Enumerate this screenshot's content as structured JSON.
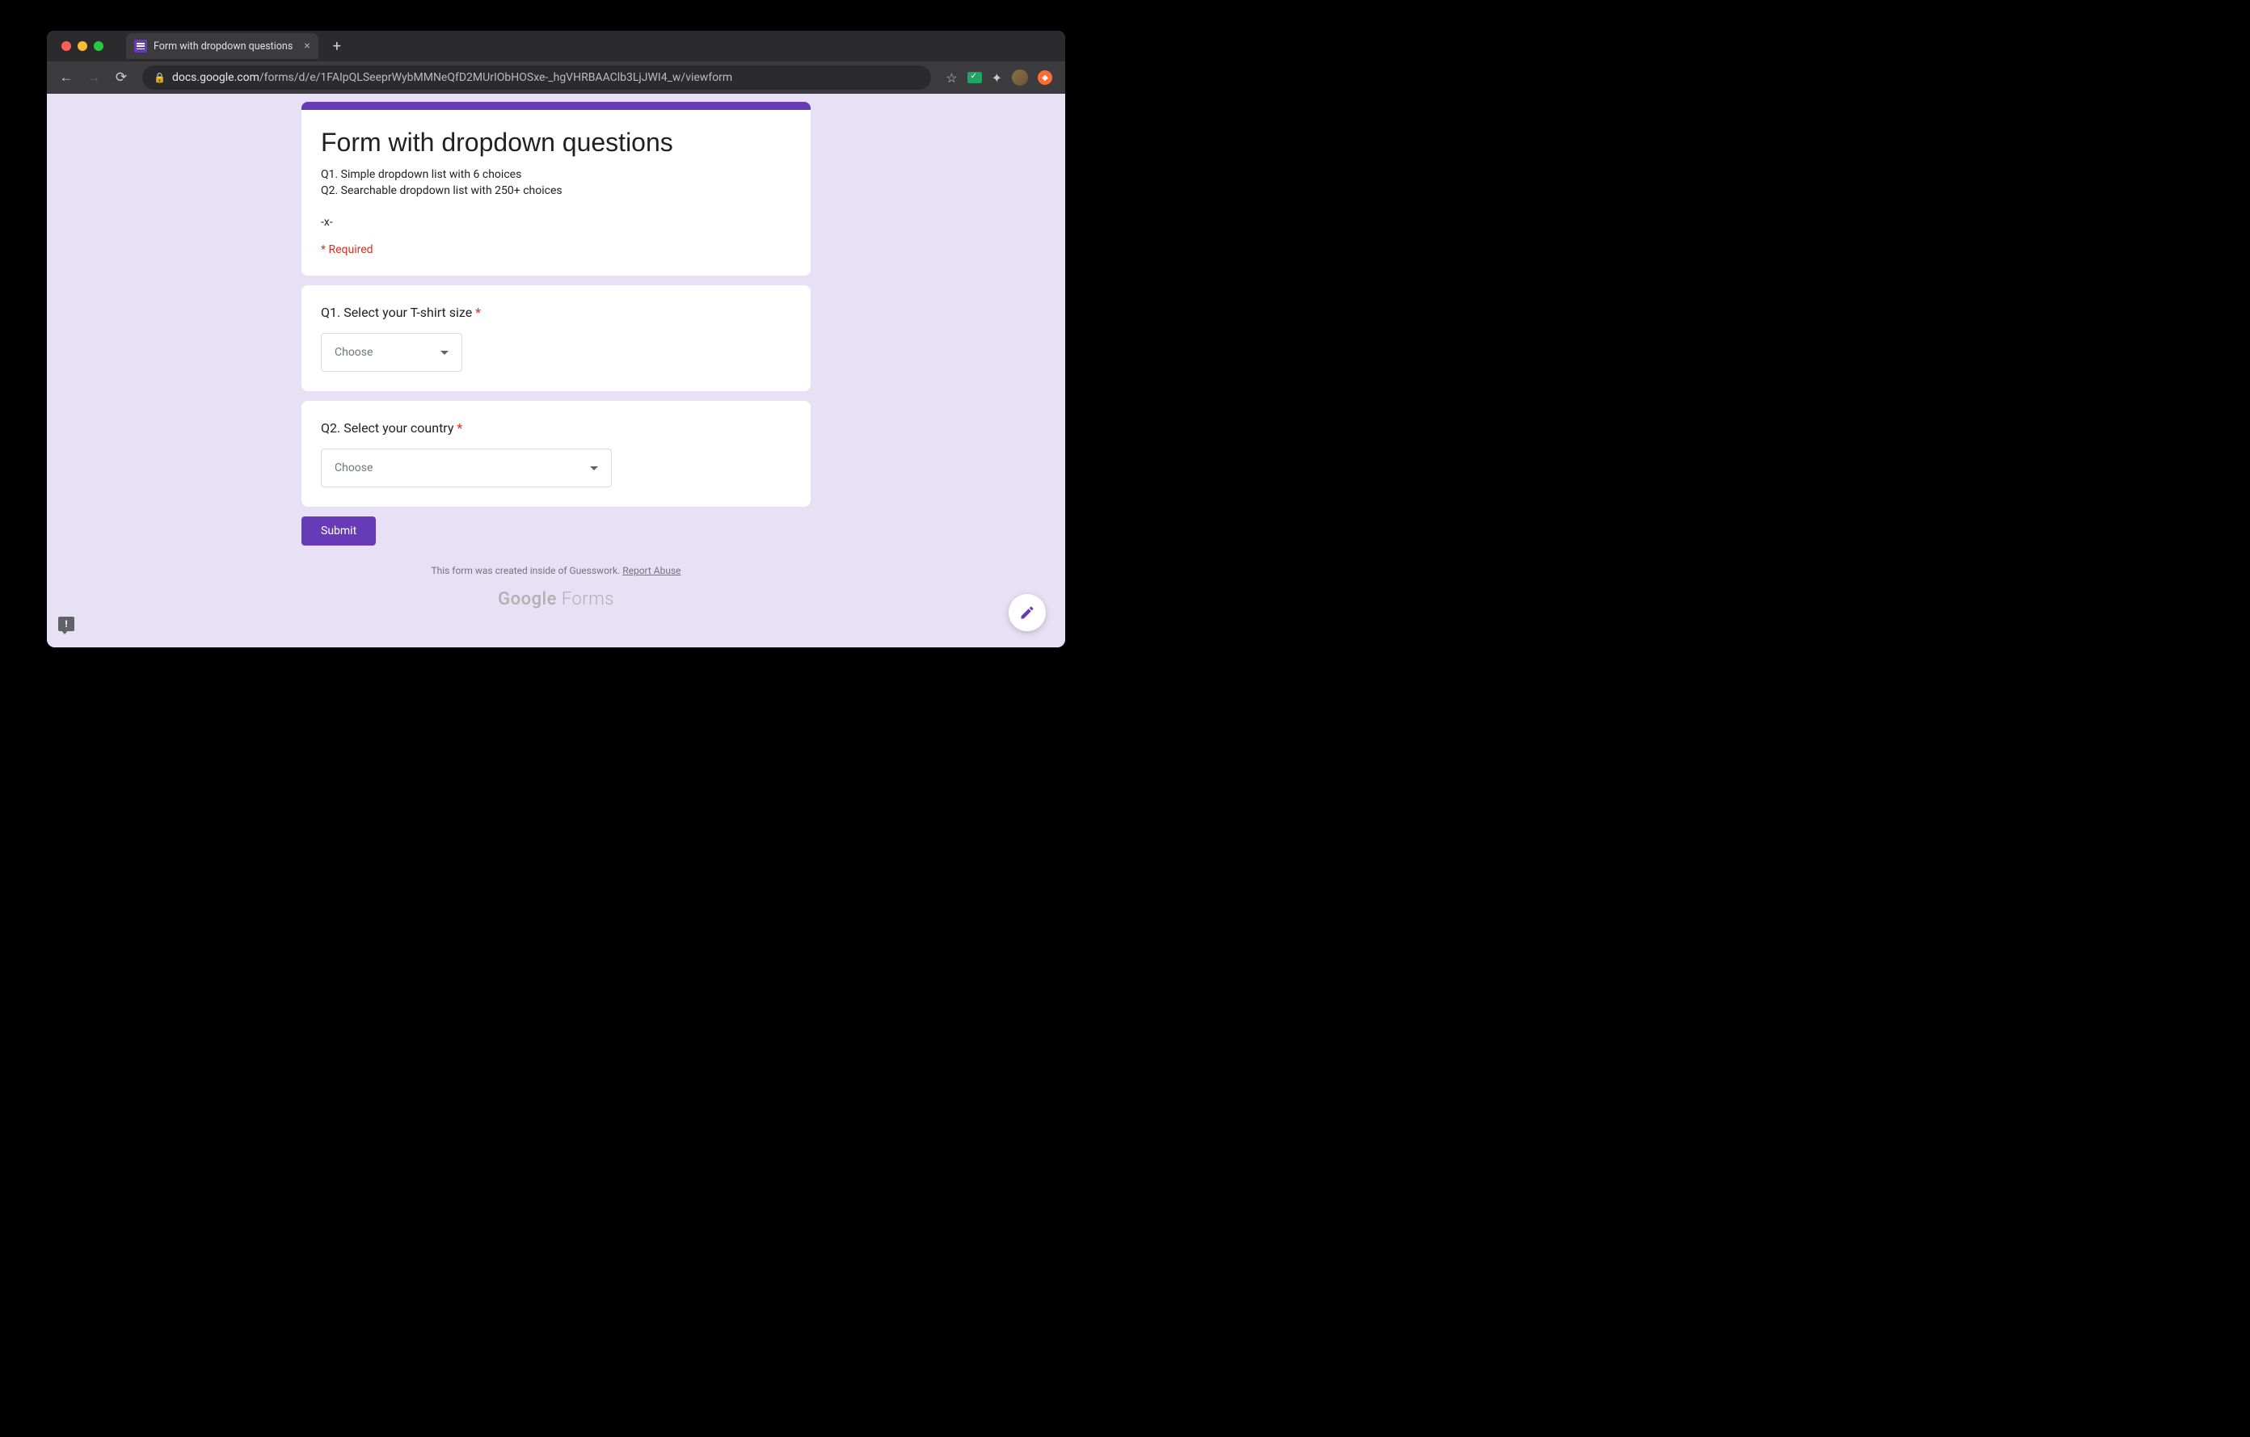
{
  "browser": {
    "tab_title": "Form with dropdown questions",
    "url_domain": "docs.google.com",
    "url_path": "/forms/d/e/1FAIpQLSeeprWybMMNeQfD2MUrIObHOSxe-_hgVHRBAAClb3LjJWI4_w/viewform"
  },
  "form": {
    "title": "Form with dropdown questions",
    "description": "Q1. Simple dropdown list with 6 choices\nQ2. Searchable dropdown list with 250+ choices\n\n-x-",
    "required_label": "* Required",
    "questions": [
      {
        "label": "Q1. Select your T-shirt size",
        "required": true,
        "placeholder": "Choose"
      },
      {
        "label": "Q2. Select your country",
        "required": true,
        "placeholder": "Choose"
      }
    ],
    "submit_label": "Submit",
    "footer_text": "This form was created inside of Guesswork. ",
    "report_abuse": "Report Abuse",
    "logo_google": "Google",
    "logo_forms": " Forms"
  }
}
